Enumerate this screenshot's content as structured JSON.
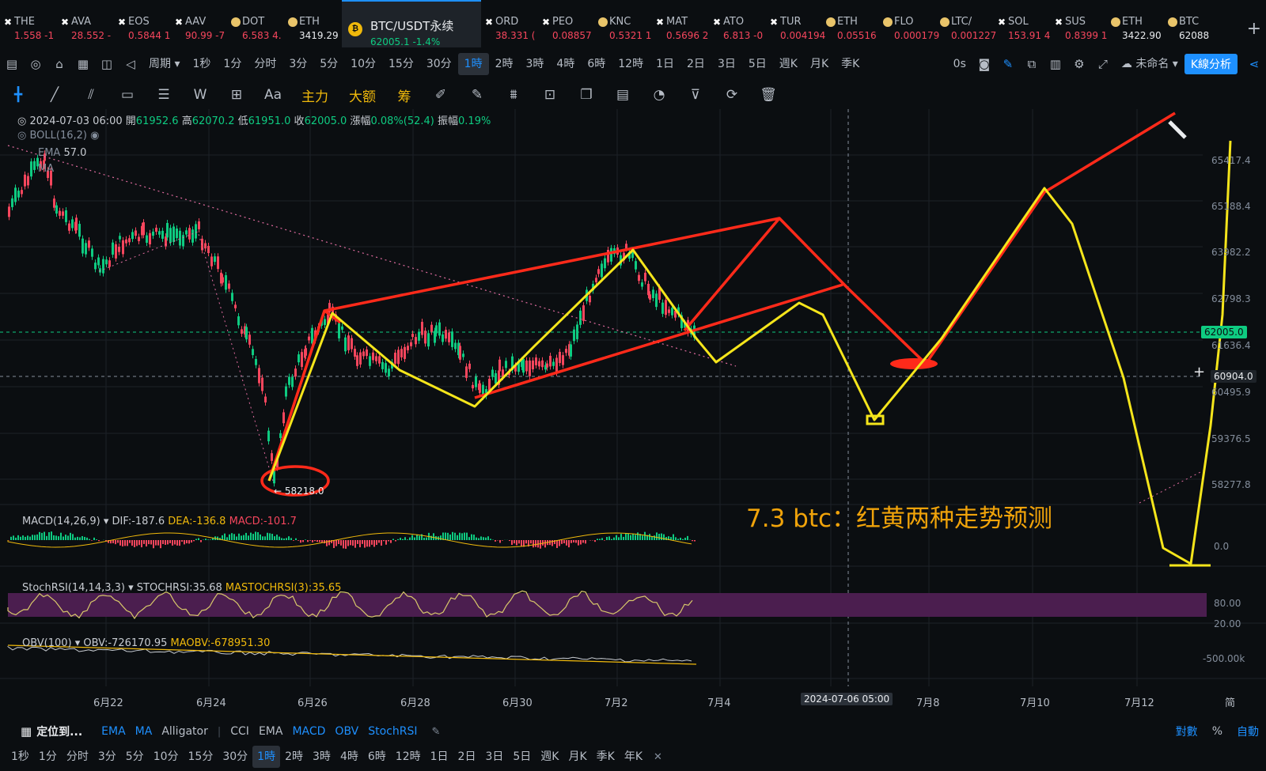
{
  "ticker": [
    {
      "sym": "THE",
      "px": "1.558 -1",
      "icon": "x"
    },
    {
      "sym": "AVA",
      "px": "28.552 -",
      "icon": "x"
    },
    {
      "sym": "EOS",
      "px": "0.5844 1",
      "icon": "x"
    },
    {
      "sym": "AAV",
      "px": "90.99 -7",
      "icon": "x"
    },
    {
      "sym": "DOT",
      "px": "6.583 4.",
      "icon": "coin"
    },
    {
      "sym": "ETH",
      "px": "3419.29",
      "icon": "coin"
    },
    {
      "sym": "BTC/USDT永续",
      "px": "62005.1 -1.4%",
      "icon": "btc",
      "active": true
    },
    {
      "sym": "ORD",
      "px": "38.331 (",
      "icon": "x"
    },
    {
      "sym": "PEO",
      "px": "0.08857",
      "icon": "x"
    },
    {
      "sym": "KNC",
      "px": "0.5321 1",
      "icon": "coin"
    },
    {
      "sym": "MAT",
      "px": "0.5696 2",
      "icon": "x"
    },
    {
      "sym": "ATO",
      "px": "6.813 -0",
      "icon": "x"
    },
    {
      "sym": "TUR",
      "px": "0.004194",
      "icon": "x"
    },
    {
      "sym": "ETH",
      "px": "0.05516",
      "icon": "coin"
    },
    {
      "sym": "FLO",
      "px": "0.000179",
      "icon": "coin"
    },
    {
      "sym": "LTC/",
      "px": "0.001227",
      "icon": "coin"
    },
    {
      "sym": "SOL",
      "px": "153.91 4",
      "icon": "x"
    },
    {
      "sym": "SUS",
      "px": "0.8399 1",
      "icon": "x"
    },
    {
      "sym": "ETH",
      "px": "3422.90",
      "icon": "coin"
    },
    {
      "sym": "BTC",
      "px": "62088",
      "icon": "coin"
    }
  ],
  "add_tab": "+",
  "intervals": {
    "period_label": "周期",
    "items": [
      "1秒",
      "1分",
      "分时",
      "3分",
      "5分",
      "10分",
      "15分",
      "30分",
      "1時",
      "2時",
      "3時",
      "4時",
      "6時",
      "12時",
      "1日",
      "2日",
      "3日",
      "5日",
      "週K",
      "月K",
      "季K"
    ],
    "active": "1時",
    "zero_s": "0s",
    "unnamed": "未命名",
    "kline_btn": "K線分析"
  },
  "drawbar": {
    "text_tool": "Aa",
    "main_force": "主力",
    "big_amount": "大额",
    "chips": "筹"
  },
  "ohlc": {
    "date": "2024-07-03 06:00",
    "open_lbl": "開",
    "open": "61952.6",
    "high_lbl": "高",
    "high": "62070.2",
    "low_lbl": "低",
    "low": "61951.0",
    "close_lbl": "收",
    "close": "62005.0",
    "chg_lbl": "漲幅",
    "chg": "0.08%(52.4)",
    "amp_lbl": "振幅",
    "amp": "0.19%"
  },
  "overlays": {
    "boll": "BOLL(16,2)",
    "ema": "EMA",
    "ma": "MA",
    "ema_val": "57.0"
  },
  "price_axis": [
    "65417.4",
    "65188.4",
    "63982.2",
    "62798.3",
    "61636.4",
    "60495.9",
    "59376.5",
    "58277.8"
  ],
  "current_price": "62005.0",
  "crosshair_price": "60904.0",
  "low_marker": "← 58218.0",
  "annotation": "7.3 btc：红黄两种走势预测",
  "macd": {
    "name": "MACD(14,26,9)",
    "dif": "DIF:-187.6",
    "dea": "DEA:-136.8",
    "macd": "MACD:-101.7",
    "zero": "0.0"
  },
  "stoch": {
    "name": "StochRSI(14,14,3,3)",
    "k": "STOCHRSI:35.68",
    "d": "MASTOCHRSI(3):35.65",
    "hi": "80.00",
    "lo": "20.00"
  },
  "obv": {
    "name": "OBV(100)",
    "obv": "OBV:-726170.95",
    "ma": "MAOBV:-678951.30",
    "axis": "-500.00k"
  },
  "x_axis": [
    "6月22",
    "6月24",
    "6月26",
    "6月28",
    "6月30",
    "7月2",
    "7月4",
    "7月8",
    "7月10",
    "7月12"
  ],
  "x_cursor": "2024-07-06 05:00",
  "axis_mode": {
    "simple": "简",
    "log": "對數",
    "pct": "%",
    "auto": "自動"
  },
  "indicator_bar": {
    "locate": "定位到...",
    "main": [
      "EMA",
      "MA",
      "Alligator"
    ],
    "sub": [
      "CCI",
      "EMA",
      "MACD",
      "OBV",
      "StochRSI"
    ]
  },
  "timeframes": [
    "1秒",
    "1分",
    "分时",
    "3分",
    "5分",
    "10分",
    "15分",
    "30分",
    "1時",
    "2時",
    "3時",
    "4時",
    "6時",
    "12時",
    "1日",
    "2日",
    "3日",
    "5日",
    "週K",
    "月K",
    "季K",
    "年K"
  ],
  "tf_active": "1時",
  "colors": {
    "up": "#0ecb81",
    "down": "#f6465d",
    "accent": "#1e90ff",
    "yellow": "#f0b90b",
    "hand_red": "#ff2a1a",
    "hand_yellow": "#f5e51b"
  }
}
